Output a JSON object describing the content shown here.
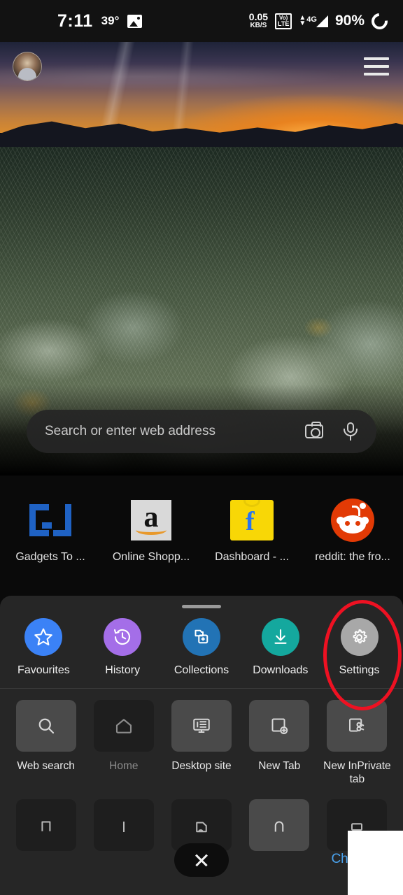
{
  "status_bar": {
    "time": "7:11",
    "temperature": "39°",
    "gallery_icon": "image-icon",
    "data_rate_value": "0.05",
    "data_rate_unit": "KB/S",
    "volte_top": "Vo)",
    "volte_bottom": "LTE",
    "network": "4G",
    "battery_percent": "90%",
    "battery_icon": "battery-ring-icon"
  },
  "top_bar": {
    "avatar": "profile-avatar",
    "menu_icon": "hamburger-menu-icon"
  },
  "search": {
    "placeholder": "Search or enter web address",
    "camera_icon": "camera-icon",
    "mic_icon": "microphone-icon"
  },
  "shortcuts": [
    {
      "label": "Gadgets To ...",
      "icon": "gadgets-to-use-logo"
    },
    {
      "label": "Online Shopp...",
      "icon": "amazon-logo"
    },
    {
      "label": "Dashboard - ...",
      "icon": "flipkart-logo"
    },
    {
      "label": "reddit: the fro...",
      "icon": "reddit-logo"
    }
  ],
  "sheet": {
    "grabber": "drag-handle",
    "quick_actions": [
      {
        "label": "Favourites",
        "icon": "star-icon",
        "color": "#3b82f6"
      },
      {
        "label": "History",
        "icon": "history-clock-icon",
        "color": "#a46ee8"
      },
      {
        "label": "Collections",
        "icon": "collections-icon",
        "color": "#2273b5"
      },
      {
        "label": "Downloads",
        "icon": "download-icon",
        "color": "#14a89e"
      },
      {
        "label": "Settings",
        "icon": "gear-icon",
        "color": "#a8a8a8"
      }
    ],
    "tiles": [
      {
        "label": "Web search",
        "icon": "search-icon",
        "enabled": true
      },
      {
        "label": "Home",
        "icon": "home-icon",
        "enabled": false
      },
      {
        "label": "Desktop site",
        "icon": "desktop-monitor-icon",
        "enabled": true
      },
      {
        "label": "New Tab",
        "icon": "new-tab-icon",
        "enabled": true
      },
      {
        "label": "New InPrivate tab",
        "icon": "inprivate-tab-icon",
        "enabled": true
      }
    ],
    "partial_tiles": [
      {
        "icon": "find-on-page-icon",
        "enabled": false
      },
      {
        "icon": "read-aloud-icon",
        "enabled": false
      },
      {
        "icon": "translate-icon",
        "enabled": false
      },
      {
        "icon": "share-icon",
        "enabled": true
      },
      {
        "icon": "print-icon",
        "enabled": false
      }
    ],
    "close_label": "close-button",
    "change_link": "Change"
  },
  "annotation": {
    "highlight_target": "Settings",
    "circle_color": "#ee1122"
  }
}
